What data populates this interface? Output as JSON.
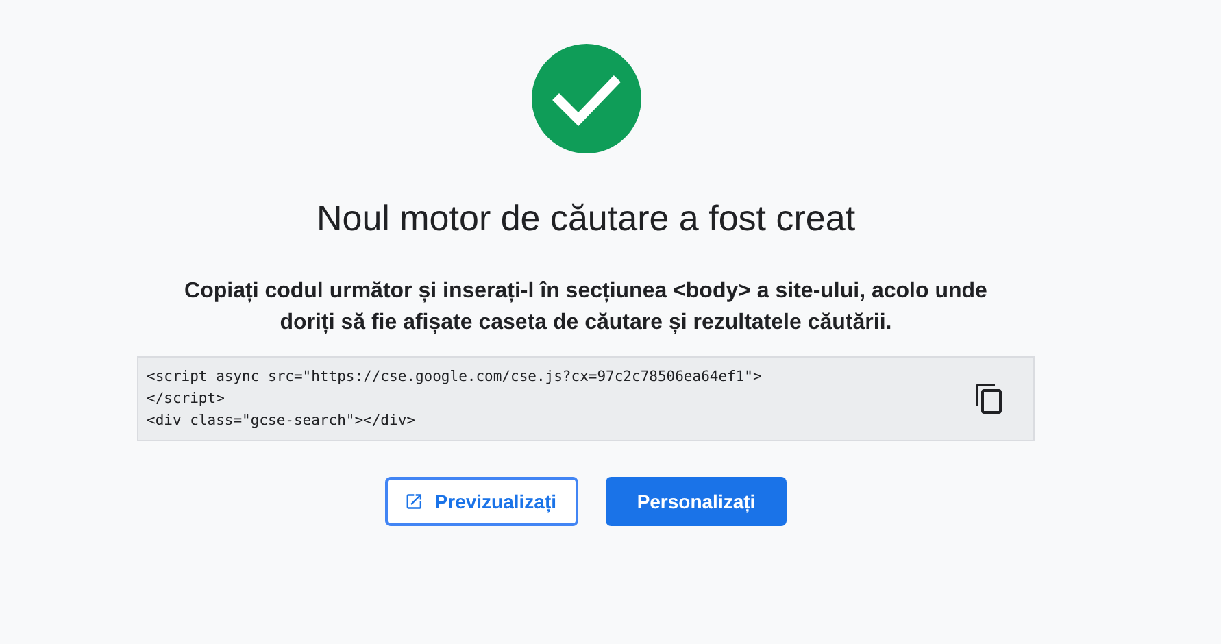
{
  "title": "Noul motor de căutare a fost creat",
  "instructions": "Copiați codul următor și inserați-l în secțiunea <body> a site-ului, acolo unde doriți să fie afișate caseta de căutare și rezultatele căutării.",
  "code_lines": [
    "<script async src=\"https://cse.google.com/cse.js?cx=97c2c78506ea64ef1\">",
    "</script>",
    "<div class=\"gcse-search\"></div>"
  ],
  "buttons": [
    {
      "label": "Previzualizați",
      "kind": "outlined"
    },
    {
      "label": "Personalizați",
      "kind": "filled"
    }
  ]
}
